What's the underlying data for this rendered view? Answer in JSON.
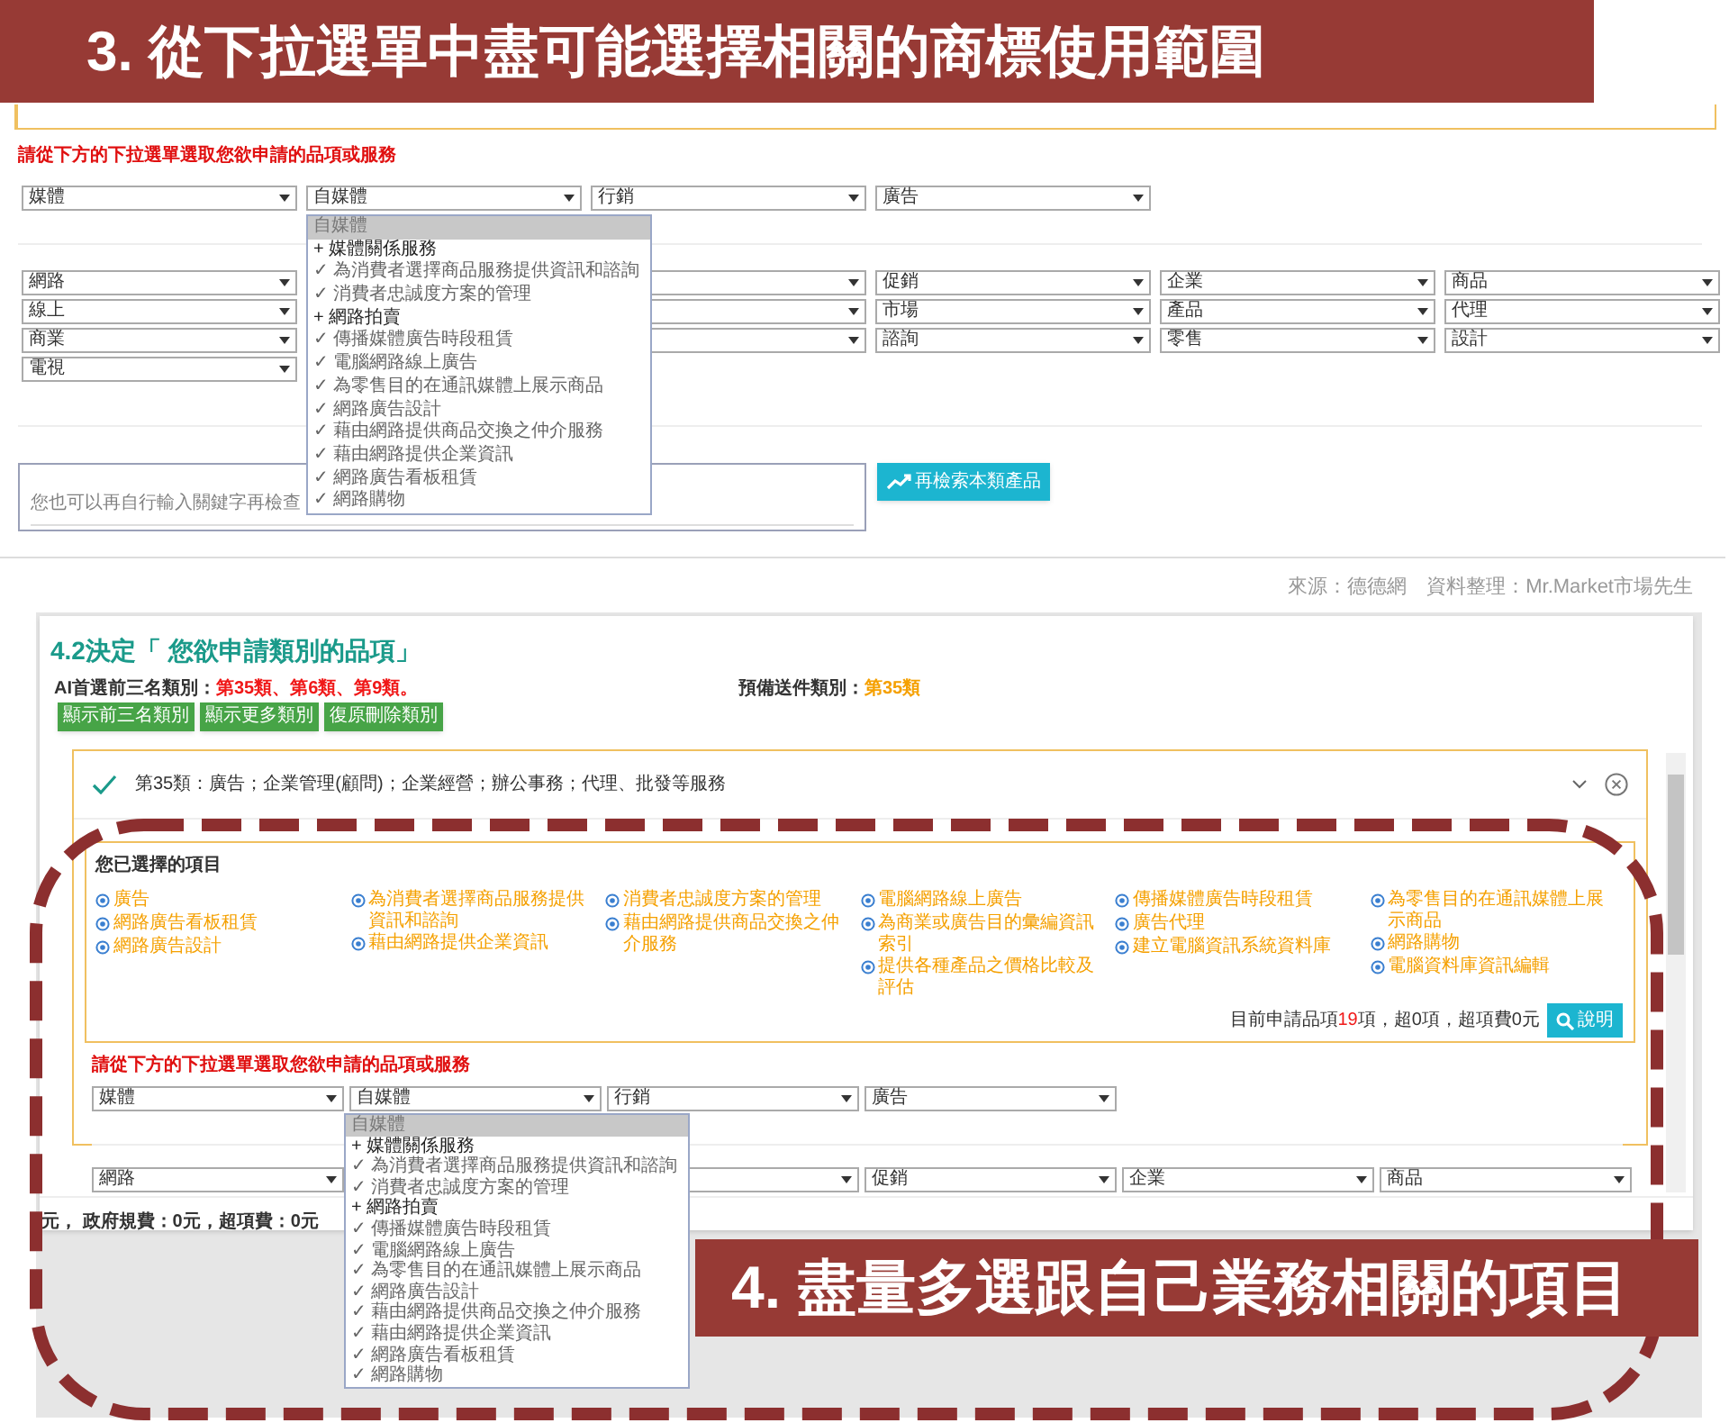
{
  "banner_top": "3. 從下拉選單中盡可能選擇相關的商標使用範圍",
  "panel_1": {
    "heading": "請從下方的下拉選單選取您欲申請的品項或服務",
    "select_row": [
      "媒體",
      "自媒體",
      "行銷",
      "廣告"
    ],
    "select_grid": [
      [
        {
          "kind": "select",
          "value": "網路"
        },
        {
          "kind": "select",
          "value": "線上"
        },
        {
          "kind": "select",
          "value": "商業"
        },
        {
          "kind": "select",
          "value": "電視"
        }
      ],
      [
        {
          "kind": "covered"
        },
        {
          "kind": "covered"
        },
        {
          "kind": "covered"
        }
      ],
      [
        {
          "kind": "select",
          "value": "促銷"
        },
        {
          "kind": "select",
          "value": "市場"
        },
        {
          "kind": "select",
          "value": "諮詢"
        }
      ],
      [
        {
          "kind": "select",
          "value": "企業"
        },
        {
          "kind": "select",
          "value": "產品"
        },
        {
          "kind": "select",
          "value": "零售"
        }
      ],
      [
        {
          "kind": "select",
          "value": "商品"
        },
        {
          "kind": "select",
          "value": "代理"
        },
        {
          "kind": "select",
          "value": "設計"
        }
      ]
    ],
    "dropdown": [
      {
        "kind": "header",
        "text": "自媒體",
        "selected": true
      },
      {
        "kind": "group",
        "text": "+ 媒體關係服務",
        "selected": false
      },
      {
        "kind": "option",
        "text": "✓ 為消費者選擇商品服務提供資訊和諮詢",
        "selected": false
      },
      {
        "kind": "option",
        "text": "✓ 消費者忠誠度方案的管理",
        "selected": false
      },
      {
        "kind": "group",
        "text": "+ 網路拍賣",
        "selected": false
      },
      {
        "kind": "option",
        "text": "✓ 傳播媒體廣告時段租賃",
        "selected": false
      },
      {
        "kind": "option",
        "text": "✓ 電腦網路線上廣告",
        "selected": false
      },
      {
        "kind": "option",
        "text": "✓ 為零售目的在通訊媒體上展示商品",
        "selected": false
      },
      {
        "kind": "option",
        "text": "✓ 網路廣告設計",
        "selected": false
      },
      {
        "kind": "option",
        "text": "✓ 藉由網路提供商品交換之仲介服務",
        "selected": false
      },
      {
        "kind": "option",
        "text": "✓ 藉由網路提供企業資訊",
        "selected": false
      },
      {
        "kind": "option",
        "text": "✓ 網路廣告看板租賃",
        "selected": false
      },
      {
        "kind": "option",
        "text": "✓ 網路購物",
        "selected": false
      }
    ],
    "keyword_placeholder": "您也可以再自行輸入關鍵字再檢查",
    "search_button": "再檢索本類產品"
  },
  "source": "來源：德德網　資料整理：Mr.Market市場先生",
  "panel_2": {
    "title": "4.2決定「 您欲申請類別的品項」",
    "ai_label": "AI首選前三名類別：",
    "ai_value": "第35類、第6類、第9類。",
    "ready_label": "預備送件類別：",
    "ready_value": "第35類",
    "buttons": [
      "顯示前三名類別",
      "顯示更多類別",
      "復原刪除類別"
    ],
    "category": {
      "title": "第35類：廣告；企業管理(顧問)；企業經營；辦公事務；代理、批發等服務",
      "checked": true
    },
    "selected_title": "您已選擇的項目",
    "selected_items": [
      [
        "廣告",
        "網路廣告看板租賃",
        "網路廣告設計"
      ],
      [
        "為消費者選擇商品服務提供資訊和諮詢",
        "藉由網路提供企業資訊"
      ],
      [
        "消費者忠誠度方案的管理",
        "藉由網路提供商品交換之仲介服務"
      ],
      [
        "電腦網路線上廣告",
        "為商業或廣告目的彙編資訊索引",
        "提供各種產品之價格比較及評估"
      ],
      [
        "傳播媒體廣告時段租賃",
        "廣告代理",
        "建立電腦資訊系統資料庫"
      ],
      [
        "為零售目的在通訊媒體上展示商品",
        "網路購物",
        "電腦資料庫資訊編輯"
      ]
    ],
    "count_prefix": "目前申請品項",
    "count": "19",
    "count_suffix": "項，超0項，超項費0元",
    "help_button": "說明",
    "heading": "請從下方的下拉選單選取您欲申請的品項或服務",
    "select_row": [
      "媒體",
      "自媒體",
      "行銷",
      "廣告"
    ],
    "select_row_2": [
      {
        "kind": "select",
        "value": "網路"
      },
      {
        "kind": "covered"
      },
      {
        "kind": "select",
        "value": "促銷"
      },
      {
        "kind": "select",
        "value": "企業"
      },
      {
        "kind": "select",
        "value": "商品"
      }
    ],
    "dropdown": [
      {
        "kind": "header",
        "text": "自媒體",
        "selected": true
      },
      {
        "kind": "group",
        "text": "+ 媒體關係服務",
        "selected": false
      },
      {
        "kind": "option",
        "text": "✓ 為消費者選擇商品服務提供資訊和諮詢",
        "selected": false
      },
      {
        "kind": "option",
        "text": "✓ 消費者忠誠度方案的管理",
        "selected": false
      },
      {
        "kind": "group",
        "text": "+ 網路拍賣",
        "selected": false
      },
      {
        "kind": "option",
        "text": "✓ 傳播媒體廣告時段租賃",
        "selected": false
      },
      {
        "kind": "option",
        "text": "✓ 電腦網路線上廣告",
        "selected": false
      },
      {
        "kind": "option",
        "text": "✓ 為零售目的在通訊媒體上展示商品",
        "selected": false
      },
      {
        "kind": "option",
        "text": "✓ 網路廣告設計",
        "selected": false
      },
      {
        "kind": "option",
        "text": "✓ 藉由網路提供商品交換之仲介服務",
        "selected": false
      },
      {
        "kind": "option",
        "text": "✓ 藉由網路提供企業資訊",
        "selected": false
      },
      {
        "kind": "option",
        "text": "✓ 網路廣告看板租賃",
        "selected": false
      },
      {
        "kind": "option",
        "text": "✓ 網路購物",
        "selected": false
      }
    ],
    "fee_line": "元， 政府規費：0元，超項費：0元"
  },
  "banner_bottom": "4. 盡量多選跟自己業務相關的項目"
}
